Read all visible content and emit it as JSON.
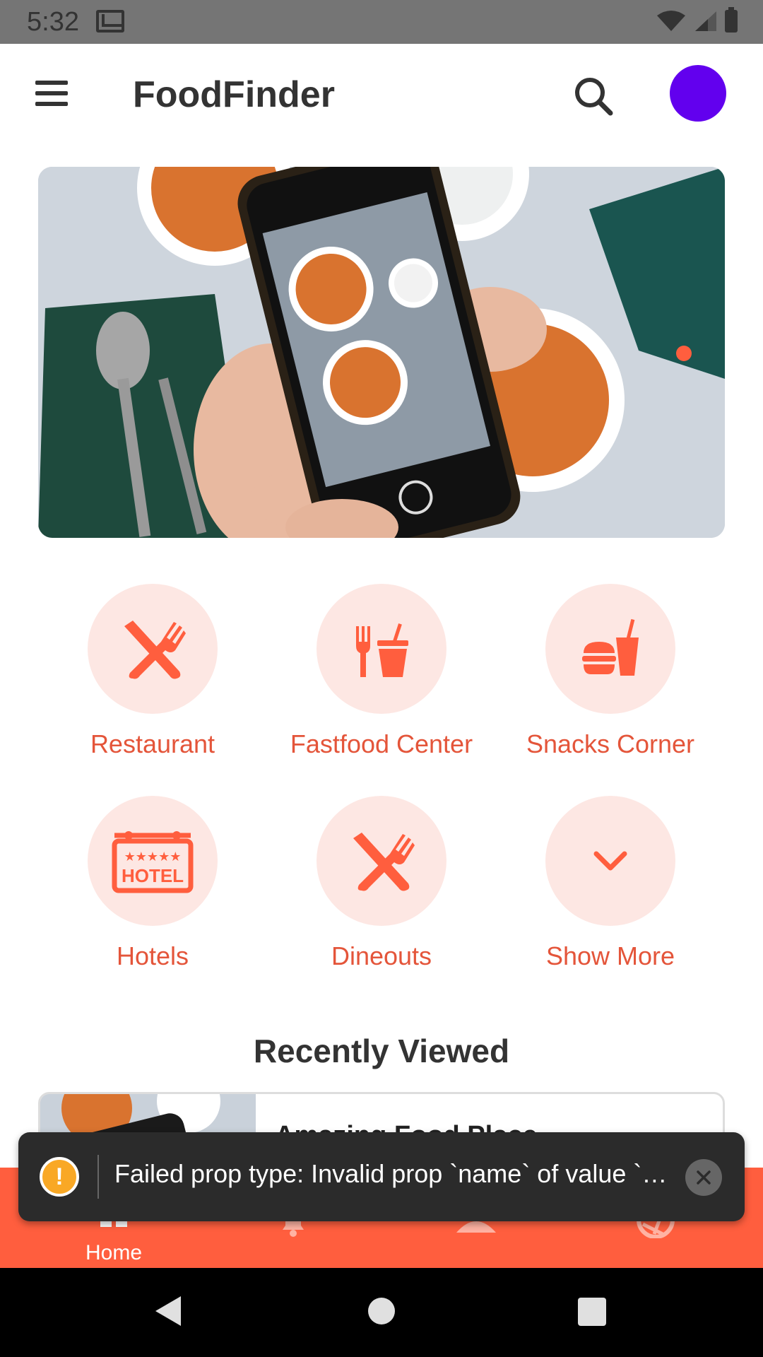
{
  "status_bar": {
    "time": "5:32"
  },
  "app_bar": {
    "title": "FoodFinder",
    "avatar_color": "#6200ee"
  },
  "hero": {
    "carousel_dots": 1
  },
  "categories": [
    {
      "label": "Restaurant",
      "icon": "utensils-icon"
    },
    {
      "label": "Fastfood Center",
      "icon": "fastfood-icon"
    },
    {
      "label": "Snacks Corner",
      "icon": "snacks-icon"
    },
    {
      "label": "Hotels",
      "icon": "hotel-icon"
    },
    {
      "label": "Dineouts",
      "icon": "utensils-icon"
    },
    {
      "label": "Show More",
      "icon": "chevron-down-icon"
    }
  ],
  "recently_viewed": {
    "title": "Recently Viewed",
    "items": [
      {
        "title": "Amazing Food Place"
      }
    ]
  },
  "bottom_nav": {
    "items": [
      {
        "label": "Home",
        "icon": "home-icon",
        "active": true
      },
      {
        "label": "",
        "icon": "bell-icon",
        "active": false
      },
      {
        "label": "",
        "icon": "user-icon",
        "active": false
      },
      {
        "label": "",
        "icon": "aperture-icon",
        "active": false
      }
    ]
  },
  "toast": {
    "message": "Failed prop type: Invalid prop `name` of value `…"
  },
  "colors": {
    "accent": "#ff5e3e",
    "accent_text": "#e4553a",
    "accent_bg": "#fde7e3"
  }
}
